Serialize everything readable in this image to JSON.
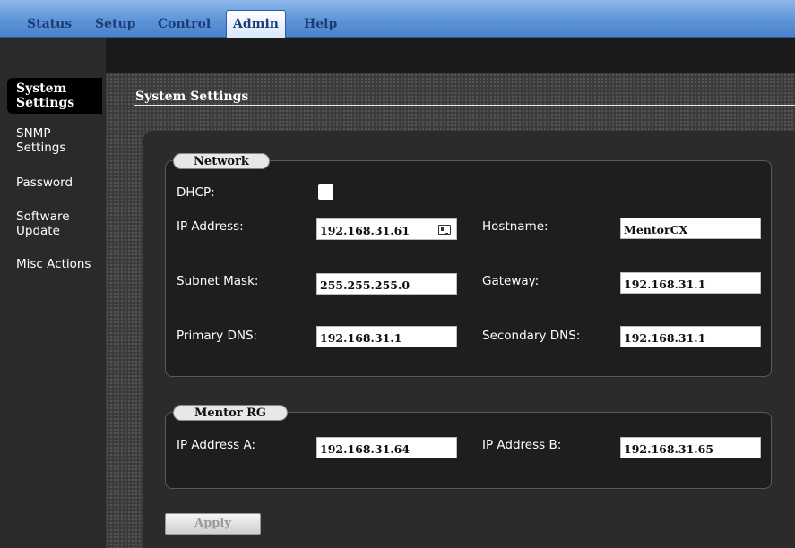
{
  "nav": {
    "tabs": [
      {
        "label": "Status",
        "active": false
      },
      {
        "label": "Setup",
        "active": false
      },
      {
        "label": "Control",
        "active": false
      },
      {
        "label": "Admin",
        "active": true
      },
      {
        "label": "Help",
        "active": false
      }
    ]
  },
  "sidebar": {
    "items": [
      {
        "label": "System Settings",
        "active": true
      },
      {
        "label": "SNMP Settings",
        "active": false
      },
      {
        "label": "Password",
        "active": false
      },
      {
        "label": "Software Update",
        "active": false
      },
      {
        "label": "Misc Actions",
        "active": false
      }
    ]
  },
  "page": {
    "title": "System Settings"
  },
  "network": {
    "legend": "Network",
    "dhcp_label": "DHCP:",
    "dhcp_checked": false,
    "ip_label": "IP Address:",
    "ip_value": "192.168.31.61",
    "hostname_label": "Hostname:",
    "hostname_value": "MentorCX",
    "subnet_label": "Subnet Mask:",
    "subnet_value": "255.255.255.0",
    "gateway_label": "Gateway:",
    "gateway_value": "192.168.31.1",
    "pdns_label": "Primary DNS:",
    "pdns_value": "192.168.31.1",
    "sdns_label": "Secondary DNS:",
    "sdns_value": "192.168.31.1"
  },
  "mentor": {
    "legend": "Mentor RG",
    "ipa_label": "IP Address A:",
    "ipa_value": "192.168.31.64",
    "ipb_label": "IP Address B:",
    "ipb_value": "192.168.31.65"
  },
  "actions": {
    "apply_label": "Apply"
  },
  "icons": {
    "ip_field_icon": "contact-card-icon"
  },
  "colors": {
    "nav_blue": "#5d94d8",
    "nav_text": "#1b3e79",
    "panel": "#2b2b2b"
  }
}
